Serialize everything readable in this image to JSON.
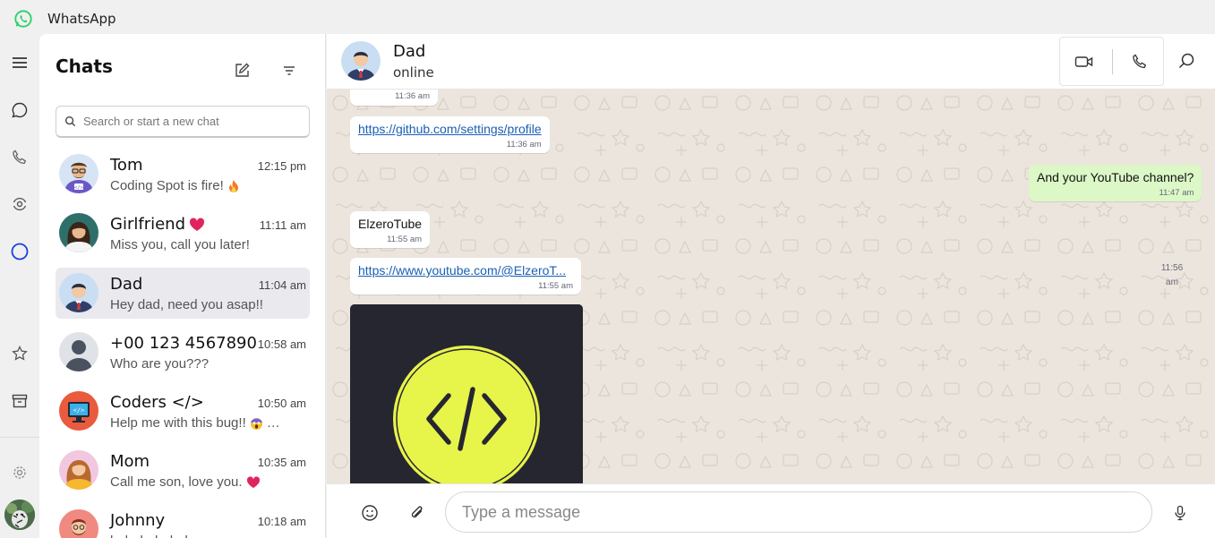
{
  "app": {
    "title": "WhatsApp"
  },
  "chats_panel": {
    "heading": "Chats",
    "search": {
      "placeholder": "Search or start a new chat",
      "value": ""
    },
    "items": [
      {
        "name": "Tom",
        "time": "12:15 pm",
        "preview": "Coding Spot is fire!",
        "preview_emoji": "fire",
        "avatar": "coder-avatar"
      },
      {
        "name": "Girlfriend",
        "name_emoji": "heart",
        "time": "11:11 am",
        "preview": "Miss you, call you later!",
        "avatar": "woman-avatar"
      },
      {
        "name": "Dad",
        "time": "11:04 am",
        "preview": "Hey dad, need you asap!!",
        "avatar": "man-avatar",
        "active": true
      },
      {
        "name": "+00 123 4567890",
        "time": "10:58 am",
        "preview": "Who are you???",
        "avatar": "default-avatar"
      },
      {
        "name": "Coders </>",
        "time": "10:50 am",
        "preview": "Help me with this bug!!",
        "preview_emoji": "screaming-face",
        "preview_ellipsis": "…",
        "avatar": "monitor-avatar"
      },
      {
        "name": "Mom",
        "time": "10:35 am",
        "preview": "Call me son, love you.",
        "preview_emoji": "heart",
        "avatar": "mom-avatar"
      },
      {
        "name": "Johnny",
        "time": "10:18 am",
        "preview": "hahahahahah",
        "avatar": "johnny-avatar"
      }
    ]
  },
  "conversation": {
    "contact_name": "Dad",
    "contact_status": "online",
    "messages": [
      {
        "direction": "in",
        "time": "11:36 am"
      },
      {
        "direction": "in",
        "text": "https://github.com/settings/profile",
        "link": true,
        "time": "11:36 am"
      },
      {
        "direction": "out",
        "text": "And your YouTube channel?",
        "time": "11:47 am"
      },
      {
        "direction": "in",
        "text": "ElzeroTube",
        "time": "11:55 am"
      },
      {
        "direction": "in",
        "text": "https://www.youtube.com/@ElzeroT...",
        "link": true,
        "time": "11:55 am"
      },
      {
        "direction": "in",
        "type": "image",
        "image": "code-logo",
        "time_line1": "11:56",
        "time_line2": "am"
      }
    ]
  },
  "composer": {
    "placeholder": "Type a message",
    "value": ""
  },
  "colors": {
    "accent_blue": "#1a3fe0",
    "chat_bg": "#ece5dd",
    "outgoing_bubble": "#dcf8c6",
    "logo_yellow": "#e7f44a",
    "logo_dark": "#262631",
    "whatsapp_green": "#25d366"
  }
}
